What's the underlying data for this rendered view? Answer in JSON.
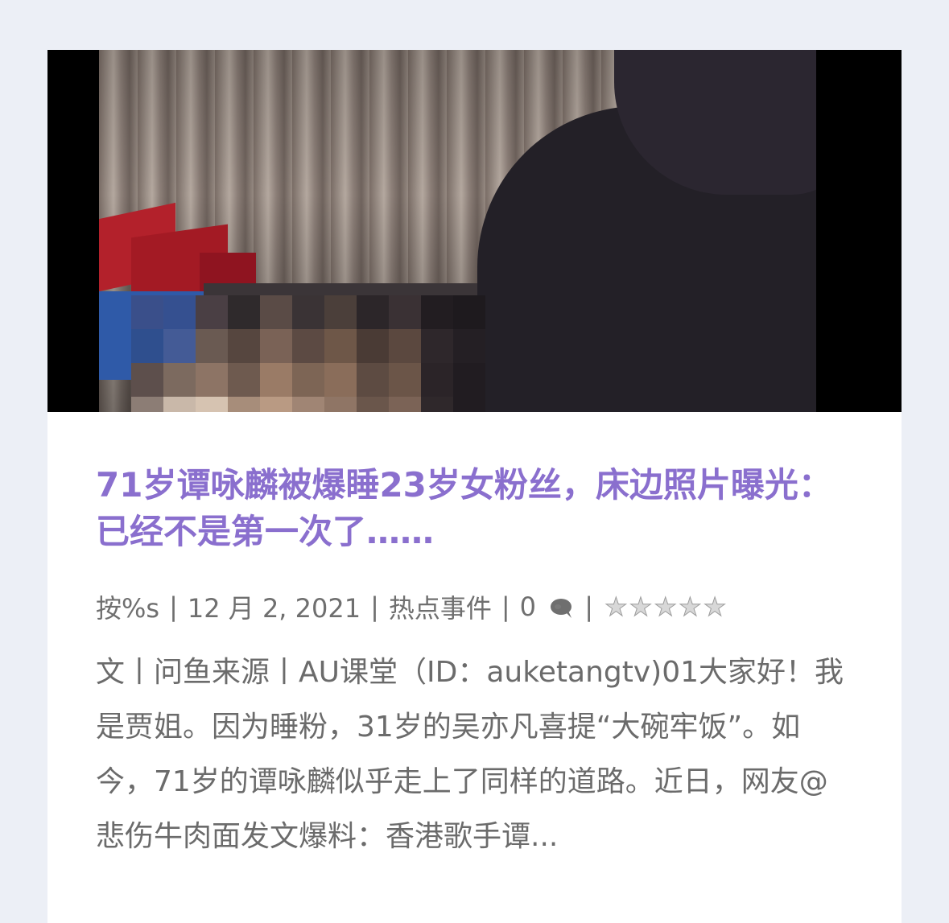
{
  "post": {
    "thumbnail_icon": "video-still-image",
    "title": "71岁谭咏麟被爆睡23岁女粉丝，床边照片曝光：已经不是第一次了……",
    "meta": {
      "author": "按%s",
      "separator": "|",
      "date": "12 月 2, 2021",
      "category": "热点事件",
      "comment_count": "0",
      "comment_icon": "comment-bubble-icon",
      "rating_stars_total": 5,
      "rating_stars_filled": 0,
      "star_glyph": "★"
    },
    "excerpt": "文丨问鱼来源丨AU课堂（ID：auketangtv)01大家好！我是贾姐。因为睡粉，31岁的吴亦凡喜提“大碗牢饭”。如今，71岁的谭咏麟似乎走上了同样的道路。近日，网友@悲伤牛肉面发文爆料：香港歌手谭..."
  },
  "colors": {
    "page_background": "#eceff6",
    "card_background": "#ffffff",
    "title": "#8a6fce",
    "meta_text": "#6f6f6f",
    "excerpt_text": "#6b6b6b"
  }
}
